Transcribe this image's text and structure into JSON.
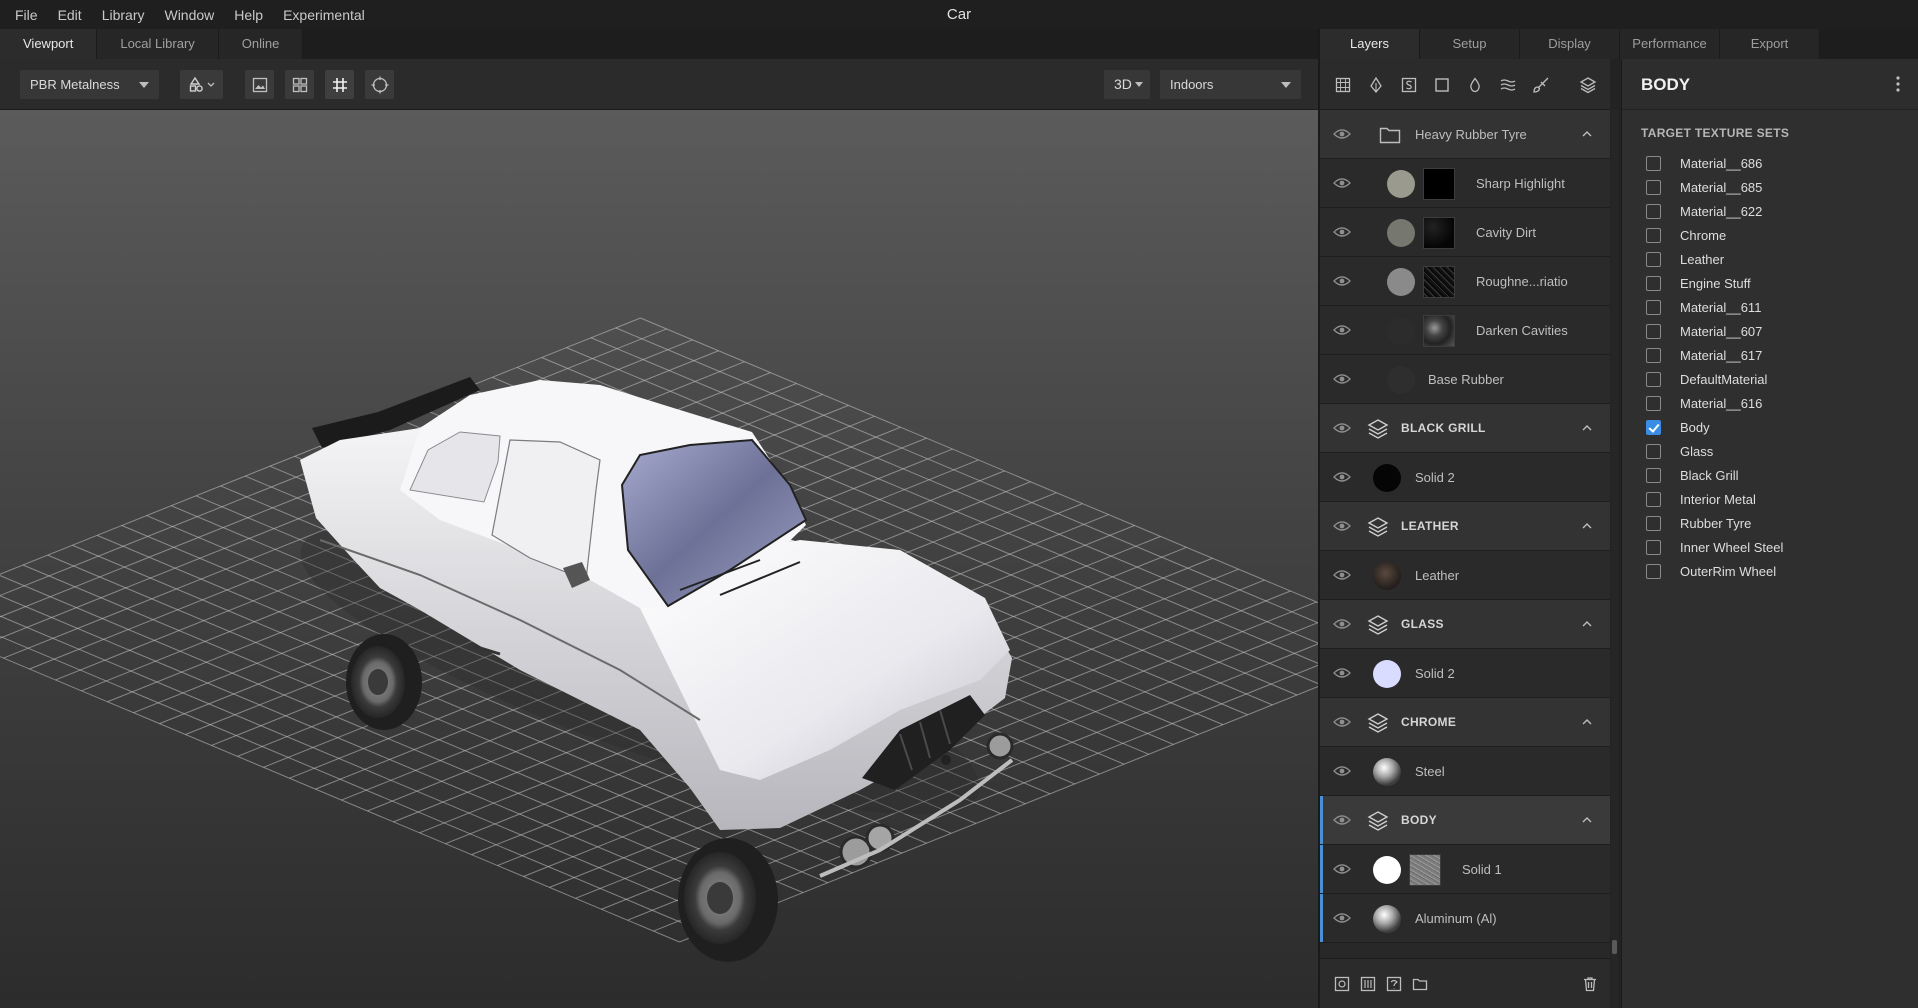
{
  "app": {
    "title": "Car",
    "menu": [
      "File",
      "Edit",
      "Library",
      "Window",
      "Help",
      "Experimental"
    ]
  },
  "left_tabs": [
    "Viewport",
    "Local Library",
    "Online"
  ],
  "viewport_toolbar": {
    "shading_mode": "PBR Metalness",
    "view_mode": "3D",
    "environment": "Indoors"
  },
  "right_tabs": [
    "Layers",
    "Setup",
    "Display",
    "Performance",
    "Export"
  ],
  "layer_tools": [
    "grid-icon",
    "pen-nib-icon",
    "stencil-s-icon",
    "square-icon",
    "drop-icon",
    "waves-icon",
    "brush-icon",
    "layers-icon"
  ],
  "layers": [
    {
      "type": "folder",
      "name": "Heavy Rubber Tyre"
    },
    {
      "type": "layer",
      "name": "Sharp Highlight",
      "swatch": "#9a9a8f",
      "mask": "black"
    },
    {
      "type": "layer",
      "name": "Cavity Dirt",
      "swatch": "#76776f",
      "mask": "dark"
    },
    {
      "type": "layer",
      "name": "Roughne...riatio",
      "swatch": "#8a8a8a",
      "mask": "noise"
    },
    {
      "type": "layer",
      "name": "Darken Cavities",
      "swatch": "#2c2c2c",
      "mask": "grunge"
    },
    {
      "type": "layer",
      "name": "Base Rubber",
      "swatch": "#2e2e2e"
    },
    {
      "type": "group",
      "name": "BLACK GRILL"
    },
    {
      "type": "layer",
      "name": "Solid 2",
      "swatch": "#050505"
    },
    {
      "type": "group",
      "name": "LEATHER"
    },
    {
      "type": "layer",
      "name": "Leather",
      "swatch": "leather"
    },
    {
      "type": "group",
      "name": "GLASS"
    },
    {
      "type": "layer",
      "name": "Solid 2",
      "swatch": "#d9dcff"
    },
    {
      "type": "group",
      "name": "CHROME"
    },
    {
      "type": "layer",
      "name": "Steel",
      "swatch": "metal"
    },
    {
      "type": "group",
      "name": "BODY",
      "selected": true
    },
    {
      "type": "layer",
      "name": "Solid 1",
      "swatch": "#ffffff",
      "mask": "gray-noise"
    },
    {
      "type": "layer",
      "name": "Aluminum (Al)",
      "swatch": "metal"
    }
  ],
  "properties": {
    "title": "BODY",
    "section": "TARGET TEXTURE SETS",
    "texture_sets": [
      {
        "name": "Material__686",
        "checked": false
      },
      {
        "name": "Material__685",
        "checked": false
      },
      {
        "name": "Material__622",
        "checked": false
      },
      {
        "name": "Chrome",
        "checked": false
      },
      {
        "name": "Leather",
        "checked": false
      },
      {
        "name": "Engine Stuff",
        "checked": false
      },
      {
        "name": "Material__611",
        "checked": false
      },
      {
        "name": "Material__607",
        "checked": false
      },
      {
        "name": "Material__617",
        "checked": false
      },
      {
        "name": "DefaultMaterial",
        "checked": false
      },
      {
        "name": "Material__616",
        "checked": false
      },
      {
        "name": "Body",
        "checked": true
      },
      {
        "name": "Glass",
        "checked": false
      },
      {
        "name": "Black Grill",
        "checked": false
      },
      {
        "name": "Interior Metal",
        "checked": false
      },
      {
        "name": "Rubber Tyre",
        "checked": false
      },
      {
        "name": "Inner Wheel Steel",
        "checked": false
      },
      {
        "name": "OuterRim Wheel",
        "checked": false
      }
    ]
  },
  "colors": {
    "accent": "#3a8ce4",
    "selection_bar": "#4a90d6"
  }
}
